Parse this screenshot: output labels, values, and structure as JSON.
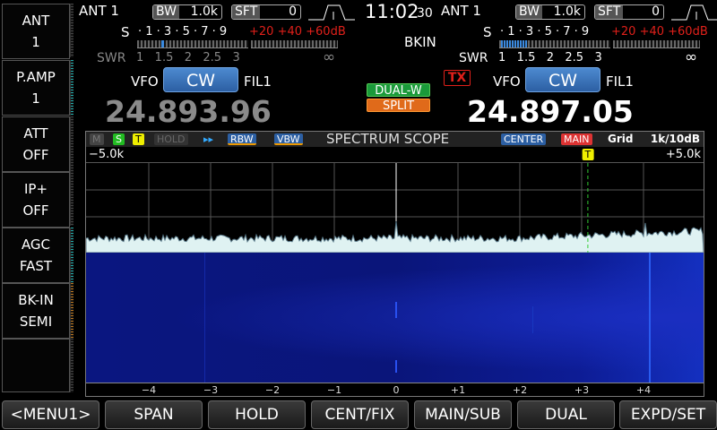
{
  "sidebar": [
    {
      "label": "ANT",
      "value": "1"
    },
    {
      "label": "P.AMP",
      "value": "1"
    },
    {
      "label": "ATT",
      "value": "OFF"
    },
    {
      "label": "IP+",
      "value": "OFF"
    },
    {
      "label": "AGC",
      "value": "FAST"
    },
    {
      "label": "BK-IN",
      "value": "SEMI"
    },
    {
      "label": "",
      "value": ""
    }
  ],
  "clock": {
    "time": "11:02",
    "seconds": "30"
  },
  "main": {
    "ant": "ANT 1",
    "bw_label": "BW",
    "bw_value": "1.0k",
    "sft_label": "SFT",
    "sft_value": "0",
    "vfo": "VFO",
    "mode": "CW",
    "filter": "FIL1",
    "frequency": "24.893.96",
    "s_meter_fraction": 0.05
  },
  "sub": {
    "ant": "ANT 1",
    "bw_label": "BW",
    "bw_value": "1.0k",
    "sft_label": "SFT",
    "sft_value": "0",
    "vfo": "VFO",
    "mode": "CW",
    "filter": "FIL1",
    "frequency": "24.897.05",
    "bkin": "BKIN",
    "tx": "TX",
    "s_meter_fraction": 0.15
  },
  "meter": {
    "s_label": "S",
    "s_scale": "· 1 · 3 · 5 · 7 · 9",
    "s_over": "+20 +40 +60dB",
    "swr_label": "SWR",
    "swr_scale": "1   1.5   2   2.5   3",
    "swr_inf": "∞"
  },
  "badges": {
    "dual": "DUAL-W",
    "split": "SPLIT"
  },
  "scope": {
    "m": "M",
    "s": "S",
    "t": "T",
    "hold": "HOLD",
    "arrows": "▸▸",
    "rbw": "RBW",
    "vbw": "VBW",
    "title": "SPECTRUM SCOPE",
    "center": "CENTER",
    "main": "MAIN",
    "grid": "Grid",
    "scale": "1k/10dB",
    "left_edge": "−5.0k",
    "right_edge": "+5.0k",
    "tx_marker": "T",
    "tx_marker_khz": 3.1,
    "axis_ticks": [
      "−4",
      "−3",
      "−2",
      "−1",
      "0",
      "+1",
      "+2",
      "+3",
      "+4"
    ]
  },
  "buttons": [
    "<MENU1>",
    "SPAN",
    "HOLD",
    "CENT/FIX",
    "MAIN/SUB",
    "DUAL",
    "EXPD/SET"
  ],
  "colors": {
    "accent_blue": "#2c5fa3",
    "dual_green": "#1a9a3a",
    "split_orange": "#e06a1a",
    "tx_red": "#e0201a",
    "waterfall": "#0a1a8a"
  }
}
